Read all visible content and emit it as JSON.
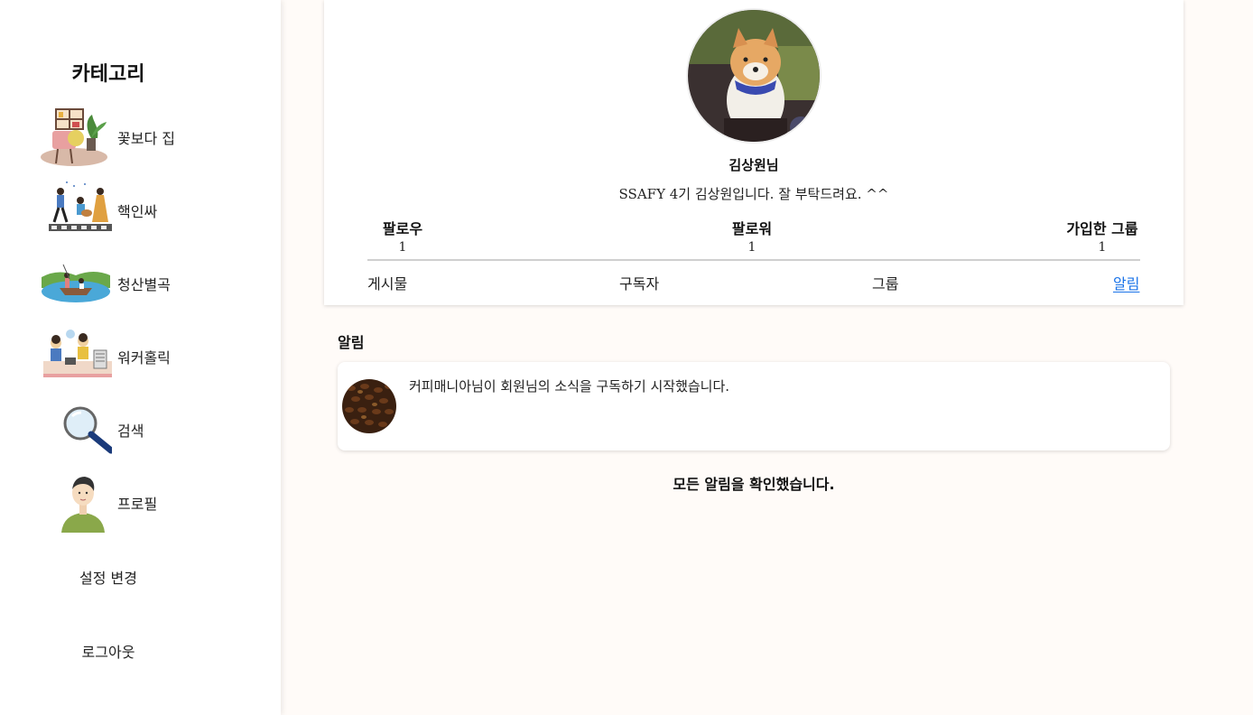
{
  "sidebar": {
    "title": "카테고리",
    "items": [
      {
        "label": "꽃보다 집",
        "icon": "home-garden-illustration"
      },
      {
        "label": "핵인싸",
        "icon": "band-performance-illustration"
      },
      {
        "label": "청산별곡",
        "icon": "boat-river-illustration"
      },
      {
        "label": "워커홀릭",
        "icon": "office-workers-illustration"
      },
      {
        "label": "검색",
        "icon": "magnifier-icon"
      },
      {
        "label": "프로필",
        "icon": "person-avatar-illustration"
      }
    ],
    "settings_label": "설정 변경",
    "logout_label": "로그아웃"
  },
  "profile": {
    "username": "김상원님",
    "bio": "SSAFY 4기 김상원입니다. 잘 부탁드려요. ^^",
    "stats": [
      {
        "label": "팔로우",
        "value": "1"
      },
      {
        "label": "팔로워",
        "value": "1"
      },
      {
        "label": "가입한 그룹",
        "value": "1"
      }
    ],
    "tabs": [
      {
        "label": "게시물",
        "active": false
      },
      {
        "label": "구독자",
        "active": false
      },
      {
        "label": "그룹",
        "active": false
      },
      {
        "label": "알림",
        "active": true
      }
    ]
  },
  "notifications": {
    "title": "알림",
    "items": [
      {
        "text": "커피매니아님이 회원님의 소식을 구독하기 시작했습니다."
      }
    ],
    "footer": "모든 알림을 확인했습니다."
  },
  "colors": {
    "accent": "#1a73e8",
    "background": "#fffbf8"
  }
}
